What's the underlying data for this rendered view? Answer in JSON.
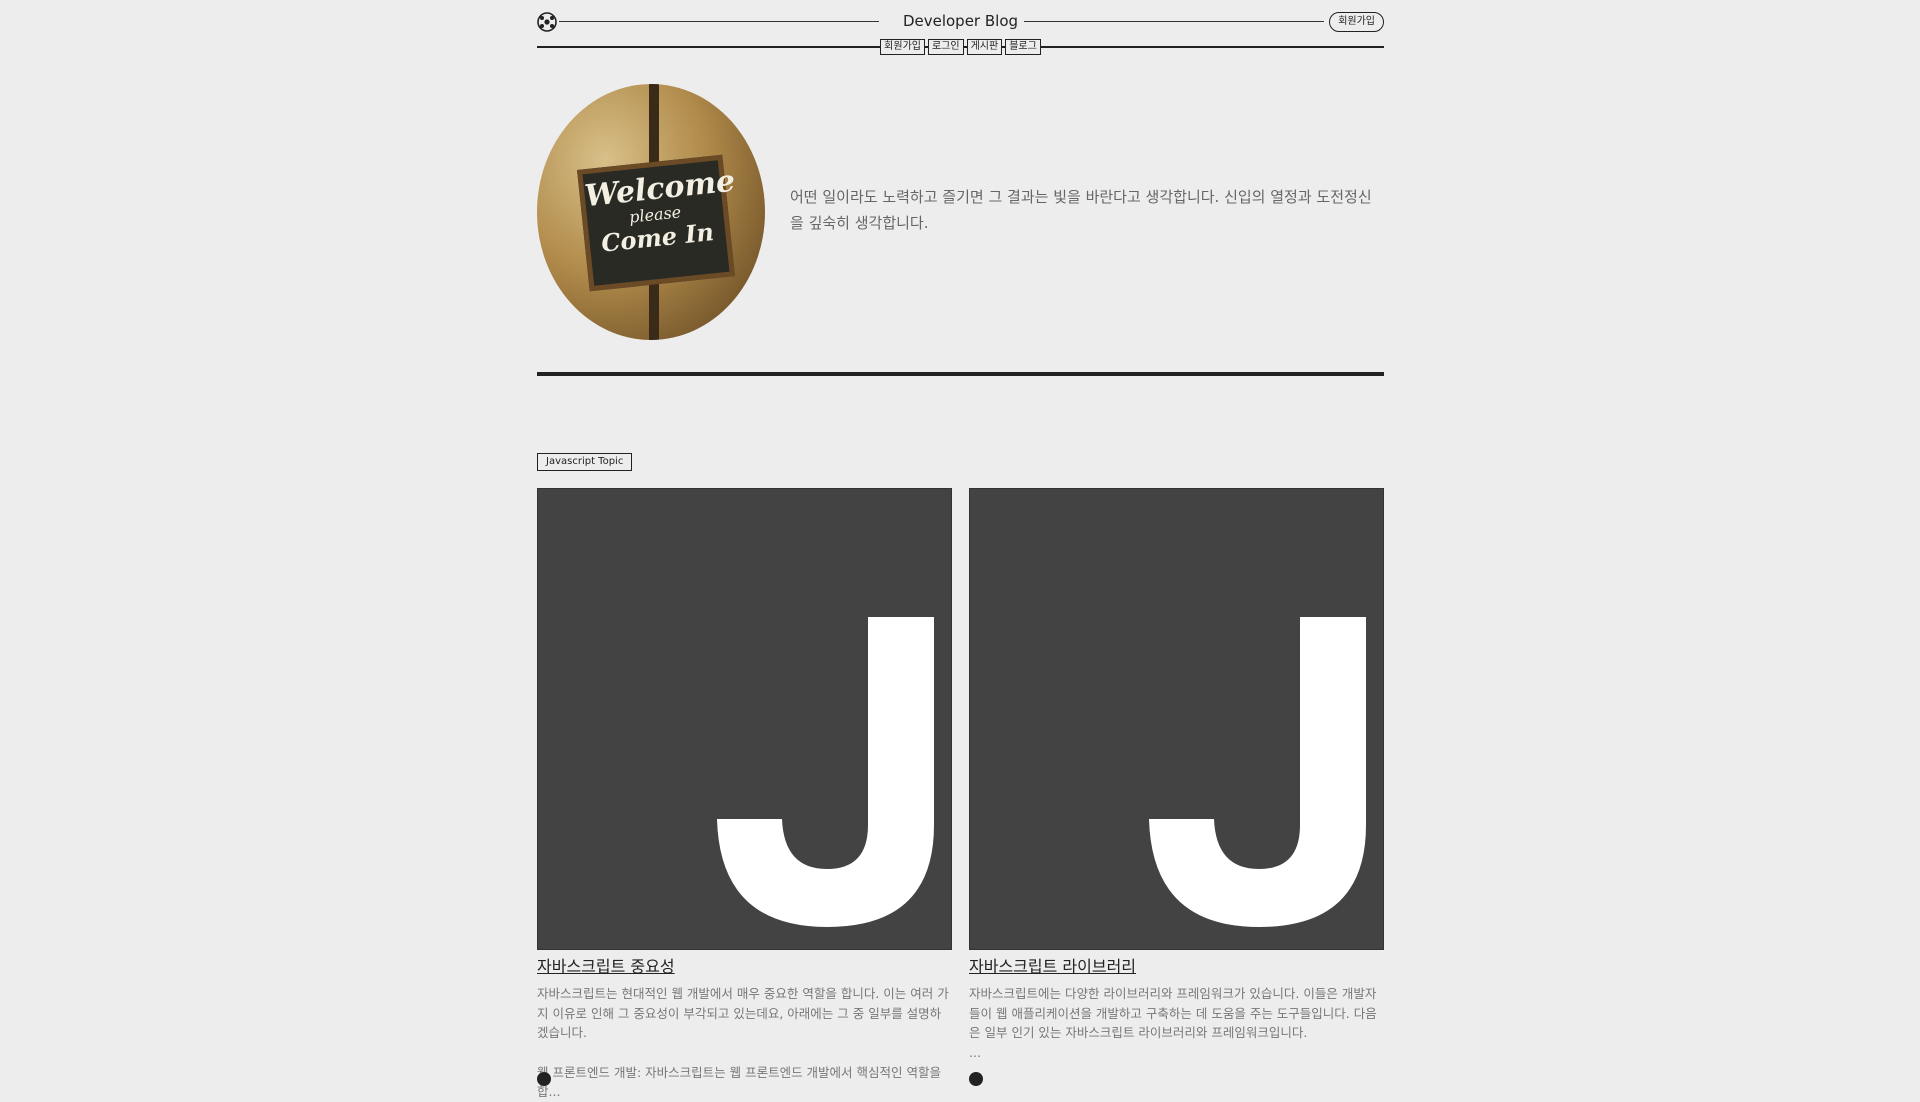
{
  "header": {
    "brand": "Developer Blog",
    "signup_pill": "회원가입",
    "logo_icon": "soccer-ball-icon",
    "nav": [
      "회원가입",
      "로그인",
      "게시판",
      "블로그"
    ]
  },
  "profile": {
    "image_alt": "Welcome please Come In",
    "sign_lines": [
      "Welcome",
      "please",
      "Come In"
    ],
    "intro": "어떤 일이라도 노력하고 즐기면 그 결과는 빛을 바란다고 생각합니다. 신입의 열정과 도전정신을 깊숙히 생각합니다."
  },
  "topic": {
    "label": "Javascript Topic"
  },
  "cards": [
    {
      "title": "자바스크립트 중요성",
      "thumb_letter": "J",
      "desc1": "자바스크립트는 현대적인 웹 개발에서 매우 중요한 역할을 합니다. 이는 여러 가지 이유로 인해 그 중요성이 부각되고 있는데요, 아래에는 그 중 일부를 설명하겠습니다.",
      "desc2": "웹 프론트엔드 개발: 자바스크립트는 웹 프론트엔드 개발에서 핵심적인 역할을 합..."
    },
    {
      "title": "자바스크립트 라이브러리",
      "thumb_letter": "J",
      "desc1": "자바스크립트에는 다양한 라이브러리와 프레임워크가 있습니다. 이들은 개발자들이 웹 애플리케이션을 개발하고 구축하는 데 도움을 주는 도구들입니다. 다음은 일부 인기 있는 자바스크립트 라이브러리와 프레임워크입니다.",
      "desc2": "..."
    }
  ]
}
